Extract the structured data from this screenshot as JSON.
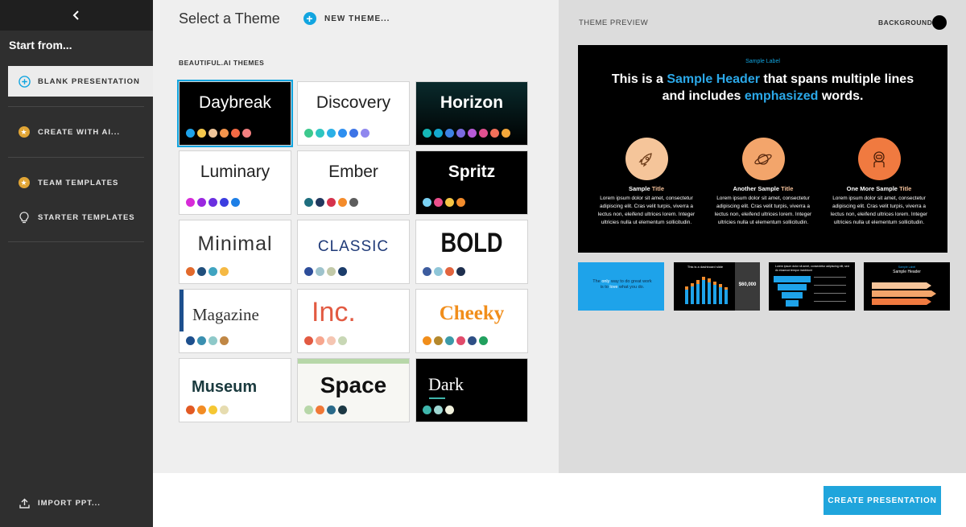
{
  "sidebar": {
    "start_from": "Start from...",
    "items": [
      {
        "label": "BLANK PRESENTATION"
      },
      {
        "label": "CREATE WITH AI..."
      },
      {
        "label": "TEAM TEMPLATES"
      },
      {
        "label": "STARTER TEMPLATES"
      },
      {
        "label": "IMPORT PPT..."
      }
    ]
  },
  "middle": {
    "title": "Select a Theme",
    "new_theme": "NEW THEME...",
    "section_label": "BEAUTIFUL.AI THEMES",
    "themes": [
      {
        "name": "Daybreak",
        "colors": [
          "#1ea3ea",
          "#f6c84c",
          "#f0c69a",
          "#f3944c",
          "#f36a44",
          "#f27f7f"
        ]
      },
      {
        "name": "Discovery",
        "colors": [
          "#3dc98e",
          "#2ec5c0",
          "#2bb0e6",
          "#2e8ff0",
          "#3d74e6",
          "#8f87ee"
        ]
      },
      {
        "name": "Horizon",
        "colors": [
          "#15b7b7",
          "#14a9cf",
          "#3d82e4",
          "#7b6ae0",
          "#b75ad8",
          "#e0508f",
          "#f2705a",
          "#f4a73a"
        ]
      },
      {
        "name": "Luminary",
        "colors": [
          "#d72bd8",
          "#9a27e0",
          "#6a2fe0",
          "#3b3de0",
          "#1e7fe6"
        ]
      },
      {
        "name": "Ember",
        "colors": [
          "#1e6e7e",
          "#21385e",
          "#d5324c",
          "#f48b2a",
          "#5d5d5d"
        ]
      },
      {
        "name": "Spritz",
        "colors": [
          "#7ad1f3",
          "#eb4f8c",
          "#f6c544",
          "#f28b2c"
        ]
      },
      {
        "name": "Minimal",
        "colors": [
          "#e26a2c",
          "#214f7c",
          "#40a4c1",
          "#f5b944"
        ]
      },
      {
        "name": "CLASSIC",
        "colors": [
          "#2d4d9a",
          "#9ec3cc",
          "#c2c9a8",
          "#1b3c6a"
        ]
      },
      {
        "name": "BOLD",
        "colors": [
          "#3d5c9e",
          "#8fc6d8",
          "#e2643e",
          "#1e2f4e"
        ]
      },
      {
        "name": "Magazine",
        "colors": [
          "#1d4f8d",
          "#3a8fb0",
          "#8ec9c9",
          "#c08745"
        ]
      },
      {
        "name": "Inc.",
        "colors": [
          "#e25a42",
          "#f7a68e",
          "#f5c5b2",
          "#c8d7b5"
        ]
      },
      {
        "name": "Cheeky",
        "colors": [
          "#f18e1b",
          "#b4882c",
          "#3b9aa8",
          "#e14b6b",
          "#2e4f85",
          "#21a05e"
        ]
      },
      {
        "name": "Museum",
        "colors": [
          "#e25a24",
          "#f28c24",
          "#f5c733",
          "#e6dcb0"
        ]
      },
      {
        "name": "Space",
        "colors": [
          "#b7d7a8",
          "#f07836",
          "#2a6a8a",
          "#1c3844"
        ]
      },
      {
        "name": "Dark",
        "colors": [
          "#3fb6ac",
          "#a0d8d3",
          "#f0f0dc"
        ]
      }
    ]
  },
  "preview": {
    "label": "THEME PREVIEW",
    "background_label": "BACKGROUND",
    "slide": {
      "sample_label": "Sample Label",
      "head_1": "This is a ",
      "head_hl1": "Sample Header",
      "head_2": " that spans multiple lines and includes ",
      "head_hl2": "emphasized",
      "head_3": " words.",
      "columns": [
        {
          "title_a": "Sample ",
          "title_b": "Title",
          "body": "Lorem ipsum dolor sit amet, consectetur adipiscing elit. Cras velit turpis, viverra a lectus non, eleifend ultrices lorem. Integer ultricies nulla ut elementum sollicitudin.",
          "color": "#f5c59a",
          "icon": "rocket-icon"
        },
        {
          "title_a": "Another Sample ",
          "title_b": "Title",
          "body": "Lorem ipsum dolor sit amet, consectetur adipiscing elit. Cras velit turpis, viverra a lectus non, eleifend ultrices lorem. Integer ultricies nulla ut elementum sollicitudin.",
          "color": "#f3a56b",
          "icon": "planet-icon"
        },
        {
          "title_a": "One More Sample ",
          "title_b": "Title",
          "body": "Lorem ipsum dolor sit amet, consectetur adipiscing elit. Cras velit turpis, viverra a lectus non, eleifend ultrices lorem. Integer ultricies nulla ut elementum sollicitudin.",
          "color": "#f07a40",
          "icon": "astronaut-icon"
        }
      ]
    },
    "thumbnails": [
      {
        "text_a": "The ",
        "text_hl1": "only",
        "text_b": " way to do great work is to ",
        "text_hl2": "love",
        "text_c": " what you do."
      },
      {
        "title": "This is a dashboard slide",
        "stat": "$60,000"
      },
      {
        "title": "Lorem ipsum dolor sit amet, consectetur adipiscing elit, sed do eiusmod tempor incididunt"
      },
      {
        "label": "Sample Label",
        "title": "Sample Header"
      }
    ]
  },
  "footer": {
    "create_label": "CREATE PRESENTATION"
  },
  "colors": {
    "accent": "#11a5e0",
    "sidebar": "#2f2f2f"
  }
}
